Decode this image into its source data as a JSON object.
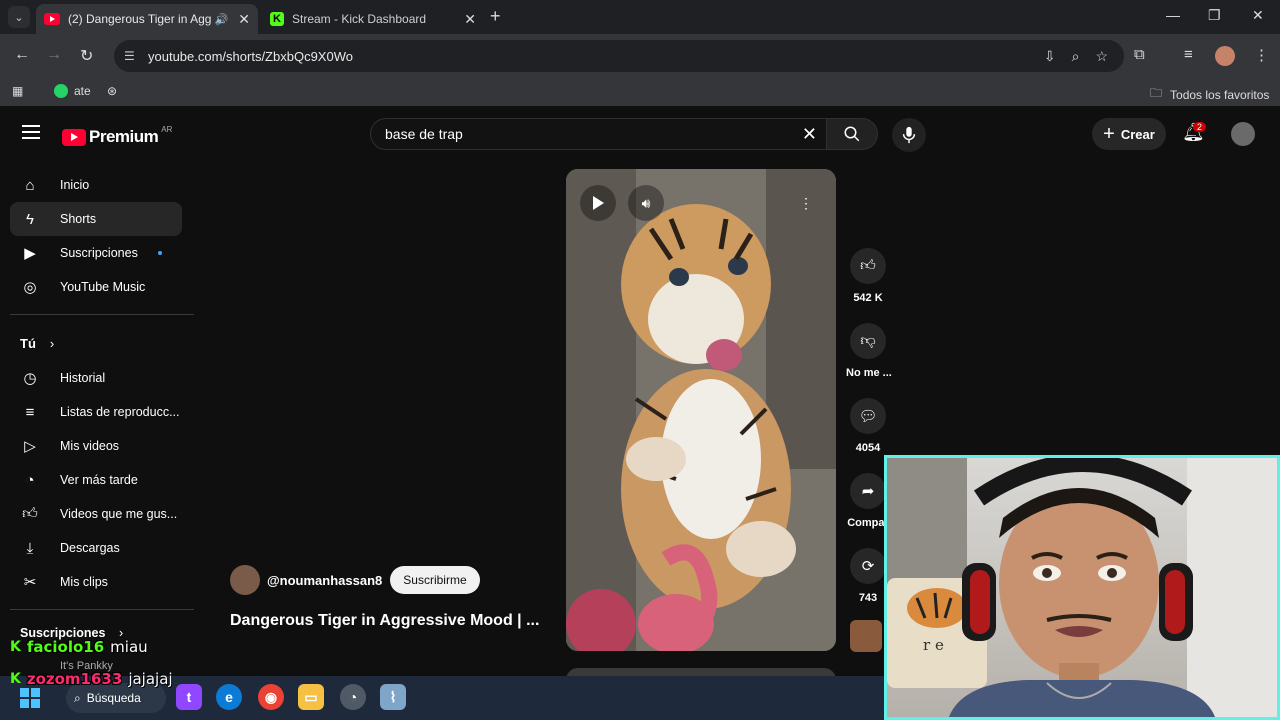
{
  "browser": {
    "tabs": [
      {
        "title": "(2) Dangerous Tiger in Agg",
        "active": true
      },
      {
        "title": "Stream - Kick Dashboard",
        "active": false
      }
    ],
    "url": "youtube.com/shorts/ZbxbQc9X0Wo",
    "bookmarks": {
      "whatsapp": "ate",
      "favorites": "Todos los favoritos"
    }
  },
  "youtube": {
    "logo_text": "Premium",
    "country_code": "AR",
    "search_query": "base de trap",
    "create_label": "Crear",
    "notification_count": "2",
    "sidebar": {
      "main": [
        {
          "label": "Inicio",
          "icon": "home-icon"
        },
        {
          "label": "Shorts",
          "icon": "shorts-icon",
          "active": true
        },
        {
          "label": "Suscripciones",
          "icon": "subscriptions-icon",
          "new": true
        },
        {
          "label": "YouTube Music",
          "icon": "music-icon"
        }
      ],
      "you_heading": "Tú",
      "you": [
        {
          "label": "Historial",
          "icon": "history-icon"
        },
        {
          "label": "Listas de reproducc...",
          "icon": "playlists-icon"
        },
        {
          "label": "Mis videos",
          "icon": "my-videos-icon"
        },
        {
          "label": "Ver más tarde",
          "icon": "watch-later-icon"
        },
        {
          "label": "Videos que me gus...",
          "icon": "liked-videos-icon"
        },
        {
          "label": "Descargas",
          "icon": "downloads-icon"
        },
        {
          "label": "Mis clips",
          "icon": "clips-icon"
        }
      ],
      "subscriptions_heading": "Suscripciones"
    },
    "short": {
      "channel": "@noumanhassan8",
      "subscribe_label": "Suscribirme",
      "title": "Dangerous Tiger in Aggressive Mood | ...",
      "likes": "542 K",
      "dislike_label": "No me ...",
      "comments": "4054",
      "share_label": "Compar",
      "remix_count": "743"
    }
  },
  "stream_overlay": {
    "chat": [
      {
        "user": "faciolo16",
        "message": "miau",
        "user_color": "#53fc18"
      },
      {
        "user": "zozom1633",
        "message": "jajajaj",
        "user_color": "#ff2a6d"
      }
    ],
    "partial_text": "It's Pankky",
    "webcam_border_color": "#5ff0e8"
  },
  "taskbar": {
    "search_label": "Búsqueda"
  }
}
